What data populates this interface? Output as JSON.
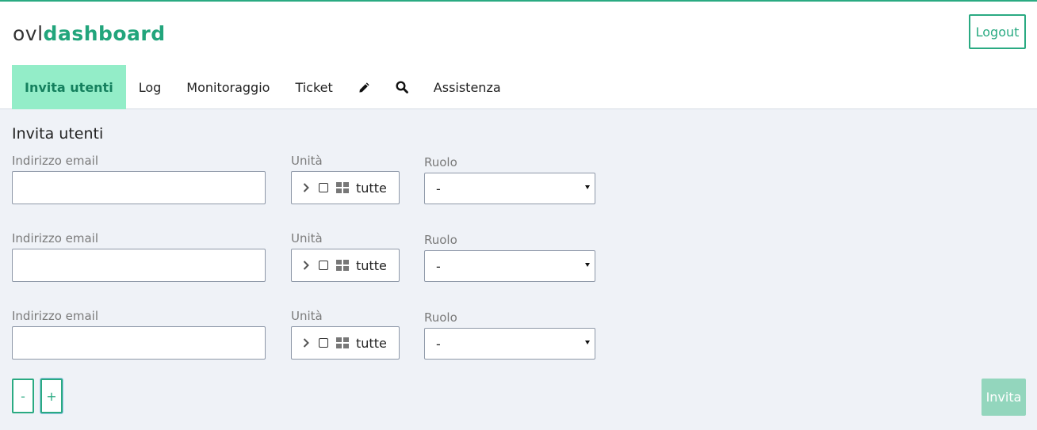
{
  "brand": {
    "prefix": "ovl",
    "main": "dashboard"
  },
  "header": {
    "logout_label": "Logout"
  },
  "nav": {
    "tabs": [
      {
        "label": "Invita utenti",
        "active": true
      },
      {
        "label": "Log"
      },
      {
        "label": "Monitoraggio"
      },
      {
        "label": "Ticket"
      },
      {
        "icon": "pencil-icon"
      },
      {
        "icon": "search-icon"
      },
      {
        "label": "Assistenza"
      }
    ]
  },
  "form": {
    "title": "Invita utenti",
    "rows": [
      {
        "email_label": "Indirizzo email",
        "email_value": "",
        "unit_label": "Unità",
        "unit_value": "tutte",
        "role_label": "Ruolo",
        "role_value": "-"
      },
      {
        "email_label": "Indirizzo email",
        "email_value": "",
        "unit_label": "Unità",
        "unit_value": "tutte",
        "role_label": "Ruolo",
        "role_value": "-"
      },
      {
        "email_label": "Indirizzo email",
        "email_value": "",
        "unit_label": "Unità",
        "unit_value": "tutte",
        "role_label": "Ruolo",
        "role_value": "-"
      }
    ],
    "remove_label": "-",
    "add_label": "+",
    "submit_label": "Invita"
  },
  "colors": {
    "accent": "#2aaa82",
    "active_tab_bg": "#93edc8",
    "page_bg": "#eff2f7",
    "submit_bg": "#93d6bd"
  }
}
